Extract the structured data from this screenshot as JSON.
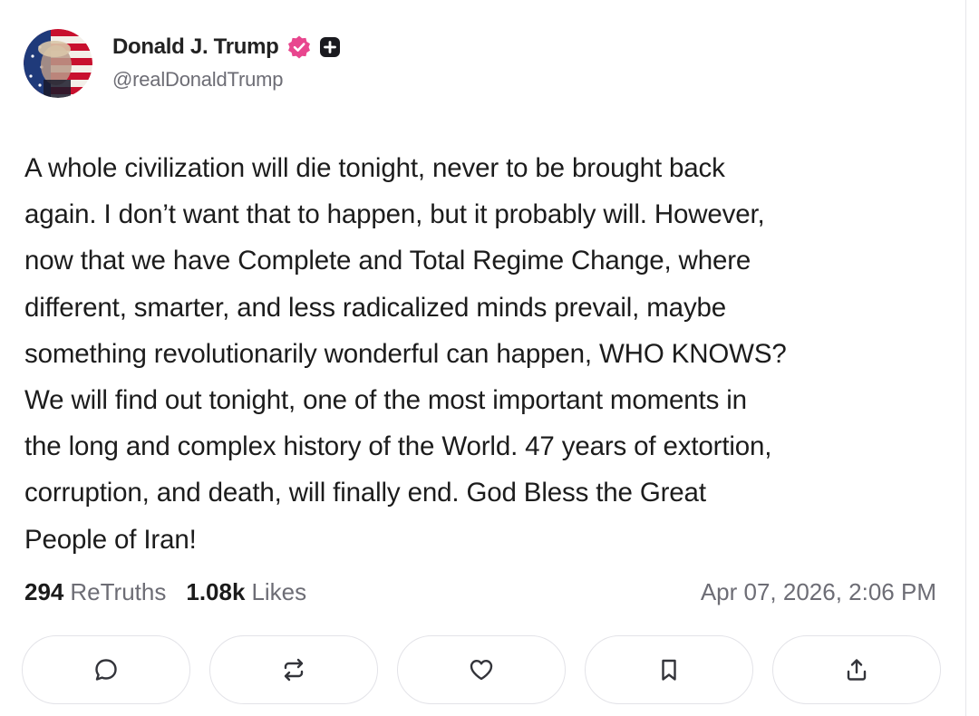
{
  "post": {
    "author": {
      "display_name": "Donald J. Trump",
      "handle": "@realDonaldTrump",
      "avatar_icon": "avatar-flag-portrait",
      "verified_icon": "verified-badge-icon",
      "plus_icon": "plus-badge-icon"
    },
    "text": "A whole civilization will die tonight, never to be brought back\nagain. I don’t want that to happen, but it probably will. However,\nnow that we have Complete and Total Regime Change, where\ndifferent, smarter, and less radicalized minds prevail, maybe\nsomething revolutionarily wonderful can happen, WHO KNOWS?\nWe will find out tonight, one of the most important moments in\nthe long and complex history of the World. 47 years of extortion,\ncorruption, and death, will finally end. God Bless the Great\nPeople of Iran!",
    "stats": {
      "retruths_count": "294",
      "retruths_label": "ReTruths",
      "likes_count": "1.08k",
      "likes_label": "Likes"
    },
    "timestamp": "Apr 07, 2026, 2:06 PM"
  },
  "actions": [
    {
      "name": "reply",
      "icon": "comment-bubble-icon"
    },
    {
      "name": "retruth",
      "icon": "repost-arrows-icon"
    },
    {
      "name": "like",
      "icon": "heart-icon"
    },
    {
      "name": "bookmark",
      "icon": "bookmark-icon"
    },
    {
      "name": "share",
      "icon": "share-upload-icon"
    }
  ],
  "colors": {
    "verified_badge": "#e8468e",
    "icon_stroke": "#33343a",
    "muted_text": "#6d6d75",
    "border": "#e3e3e8"
  }
}
